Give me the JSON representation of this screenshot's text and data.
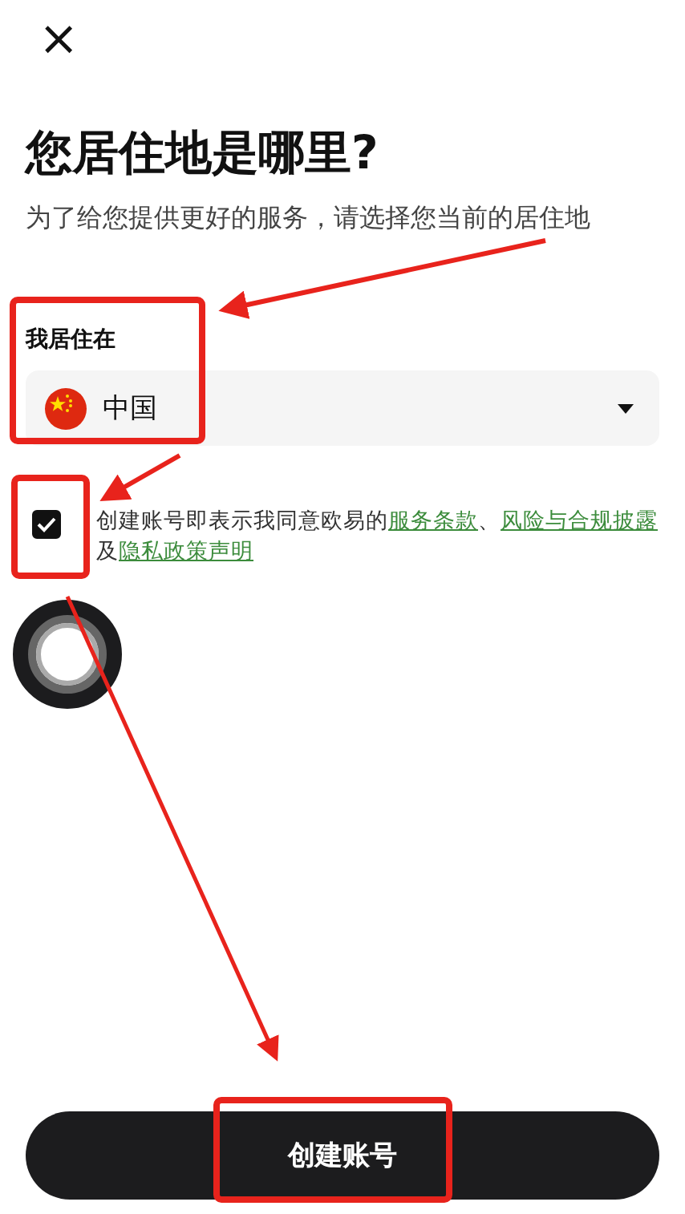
{
  "close_button": {
    "label": "×"
  },
  "title": "您居住地是哪里?",
  "subtitle": "为了给您提供更好的服务，请选择您当前的居住地",
  "residence": {
    "label": "我居住在",
    "value": "中国"
  },
  "agreement": {
    "checked": true,
    "segments": [
      {
        "kind": "plain",
        "text": "创建账号即表示我同意欧易的"
      },
      {
        "kind": "link",
        "text": "服务条款"
      },
      {
        "kind": "plain",
        "text": "、"
      },
      {
        "kind": "link",
        "text": "风险与合规披露"
      },
      {
        "kind": "plain",
        "text": "及"
      },
      {
        "kind": "link",
        "text": "隐私政策声明"
      }
    ]
  },
  "loading": true,
  "submit_button": {
    "label": "创建账号"
  }
}
